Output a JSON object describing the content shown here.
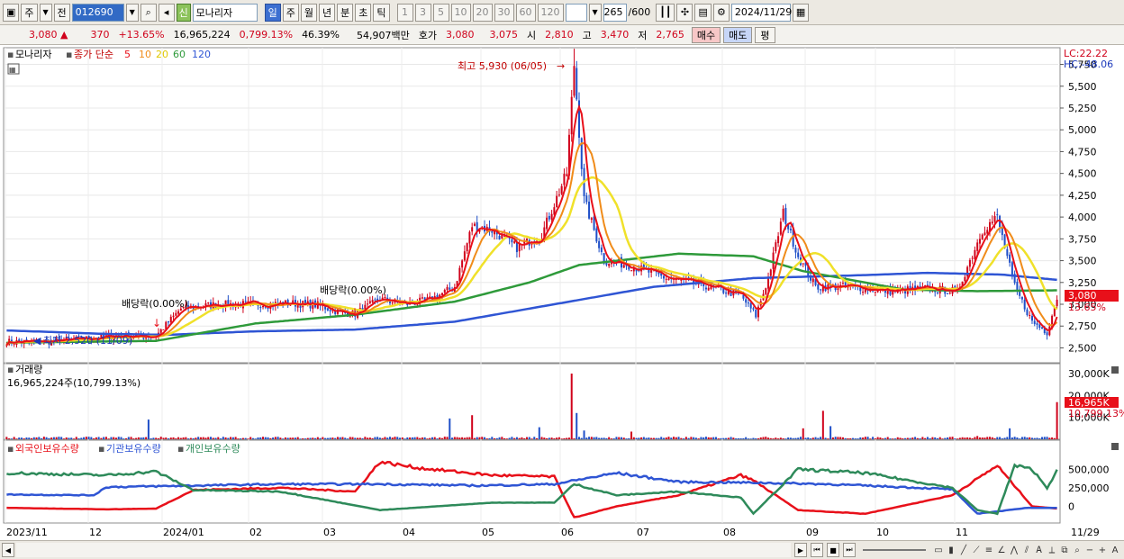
{
  "toolbar": {
    "market_label": "주",
    "prev_label": "전",
    "code_value": "012690",
    "name_badge": "신",
    "stock_name": "모나리자",
    "periods": [
      "일",
      "주",
      "월",
      "년",
      "분",
      "초",
      "틱"
    ],
    "active_period": "일",
    "intervals": [
      "1",
      "3",
      "5",
      "10",
      "20",
      "30",
      "60",
      "120"
    ],
    "count_value": "265",
    "count_max": "/600",
    "date_value": "2024/11/29"
  },
  "quote": {
    "price": "3,080",
    "change": "370",
    "change_pct": "+13.65%",
    "volume": "16,965,224",
    "volume_pct": "0,799.13%",
    "ratio": "46.39%",
    "amount": "54,907백만",
    "bid_label": "호가",
    "bid1": "3,080",
    "bid2": "3,075",
    "open_label": "시",
    "open": "2,810",
    "high_label": "고",
    "high": "3,470",
    "low_label": "저",
    "low": "2,765",
    "buy_label": "매수",
    "sell_label": "매도",
    "flat_label": "평"
  },
  "legend": {
    "name": "모나리자",
    "ma_label": "종가 단순",
    "ma_periods": [
      "5",
      "10",
      "20",
      "60",
      "120"
    ],
    "volume_title": "거래량",
    "volume_value": "16,965,224주(10,799.13%)",
    "holdings": [
      "외국인보유수량",
      "기관보유수량",
      "개인보유수량"
    ]
  },
  "annotations": {
    "high_text": "최고 5,930 (06/05)",
    "low_text": "최저 2,520 (11/09)",
    "dividend1": "배당락(0.00%)",
    "dividend2": "배당락(0.00%)",
    "lc": "LC:22.22",
    "hc": "HC:-48.06",
    "price_tag": "3,080",
    "pct_tag": "13.65%",
    "vol_tag": "16,965K",
    "vol_pct_tag": "10,799.13%"
  },
  "colors": {
    "up": "#d0021b",
    "down": "#1f4fc8",
    "ma5": "#e8101a",
    "ma10": "#f08c1a",
    "ma20": "#f0e12a",
    "ma60": "#2e9a3a",
    "ma120": "#2f55d4",
    "foreign": "#e8101a",
    "institution": "#2f55d4",
    "individual": "#2e8a5a"
  },
  "chart_data": {
    "type": "candlestick",
    "price_axis": [
      "5,750",
      "5,500",
      "5,250",
      "5,000",
      "4,750",
      "4,500",
      "4,250",
      "4,000",
      "3,750",
      "3,500",
      "3,250",
      "3,000",
      "2,750",
      "2,500"
    ],
    "price_range": [
      2350,
      5900
    ],
    "volume_axis": [
      "30,000K",
      "20,000K",
      "10,000K"
    ],
    "holding_axis": [
      "500,000",
      "250,000",
      "0"
    ],
    "x_labels": [
      "2023/11",
      "12",
      "2024/01",
      "02",
      "03",
      "04",
      "05",
      "06",
      "07",
      "08",
      "09",
      "10",
      "11",
      "11/29"
    ],
    "close_keypoints": [
      [
        0,
        2570
      ],
      [
        15,
        2570
      ],
      [
        30,
        2600
      ],
      [
        45,
        2640
      ],
      [
        55,
        2630
      ],
      [
        60,
        2640
      ],
      [
        70,
        2950
      ],
      [
        85,
        3000
      ],
      [
        100,
        3000
      ],
      [
        115,
        3010
      ],
      [
        125,
        2990
      ],
      [
        135,
        2900
      ],
      [
        140,
        2890
      ],
      [
        150,
        3060
      ],
      [
        160,
        3000
      ],
      [
        170,
        3050
      ],
      [
        180,
        3200
      ],
      [
        187,
        3900
      ],
      [
        195,
        3850
      ],
      [
        205,
        3650
      ],
      [
        215,
        3800
      ],
      [
        225,
        4500
      ],
      [
        228,
        5750
      ],
      [
        232,
        4200
      ],
      [
        240,
        3500
      ],
      [
        250,
        3450
      ],
      [
        265,
        3300
      ],
      [
        280,
        3220
      ],
      [
        295,
        3100
      ],
      [
        301,
        2870
      ],
      [
        306,
        3300
      ],
      [
        312,
        4050
      ],
      [
        318,
        3550
      ],
      [
        325,
        3200
      ],
      [
        340,
        3200
      ],
      [
        355,
        3150
      ],
      [
        370,
        3180
      ],
      [
        382,
        3150
      ],
      [
        392,
        3850
      ],
      [
        398,
        4000
      ],
      [
        405,
        3200
      ],
      [
        412,
        2800
      ],
      [
        418,
        2680
      ],
      [
        422,
        3080
      ]
    ],
    "ma120_keypoints": [
      [
        0,
        2700
      ],
      [
        40,
        2660
      ],
      [
        65,
        2650
      ],
      [
        100,
        2690
      ],
      [
        140,
        2710
      ],
      [
        180,
        2800
      ],
      [
        210,
        2950
      ],
      [
        230,
        3050
      ],
      [
        260,
        3200
      ],
      [
        300,
        3300
      ],
      [
        340,
        3330
      ],
      [
        370,
        3360
      ],
      [
        400,
        3340
      ],
      [
        422,
        3280
      ]
    ],
    "ma60_keypoints": [
      [
        0,
        2560
      ],
      [
        60,
        2580
      ],
      [
        100,
        2780
      ],
      [
        140,
        2880
      ],
      [
        180,
        3030
      ],
      [
        210,
        3250
      ],
      [
        230,
        3450
      ],
      [
        270,
        3580
      ],
      [
        300,
        3550
      ],
      [
        320,
        3380
      ],
      [
        360,
        3170
      ],
      [
        390,
        3150
      ],
      [
        422,
        3160
      ]
    ]
  }
}
